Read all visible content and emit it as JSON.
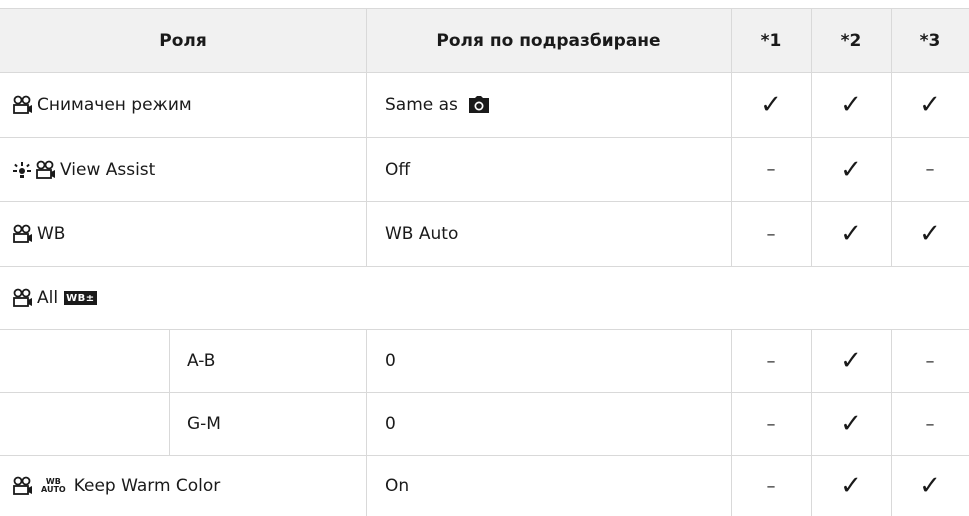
{
  "header": {
    "col_role": "Роля",
    "col_default": "Роля по подразбиране",
    "col_1": "*1",
    "col_2": "*2",
    "col_3": "*3"
  },
  "rows": [
    {
      "name": "Снимачен режим",
      "default": "Same as",
      "default_icon": "camera-icon",
      "c1": "✓",
      "c2": "✓",
      "c3": "✓"
    },
    {
      "name": "View Assist",
      "default": "Off",
      "c1": "–",
      "c2": "✓",
      "c3": "–"
    },
    {
      "name": "WB",
      "default": "WB Auto",
      "c1": "–",
      "c2": "✓",
      "c3": "✓"
    },
    {
      "name": "All",
      "badge": "WB±"
    },
    {
      "name": "A-B",
      "default": "0",
      "c1": "–",
      "c2": "✓",
      "c3": "–"
    },
    {
      "name": "G-M",
      "default": "0",
      "c1": "–",
      "c2": "✓",
      "c3": "–"
    },
    {
      "name": "Keep Warm Color",
      "prefix_top": "WB",
      "prefix_bottom": "AUTO",
      "default": "On",
      "c1": "–",
      "c2": "✓",
      "c3": "✓"
    }
  ],
  "icons": {
    "movie": "movie-camera-icon",
    "assist": "sparkle-icon",
    "camera": "camera-icon"
  }
}
